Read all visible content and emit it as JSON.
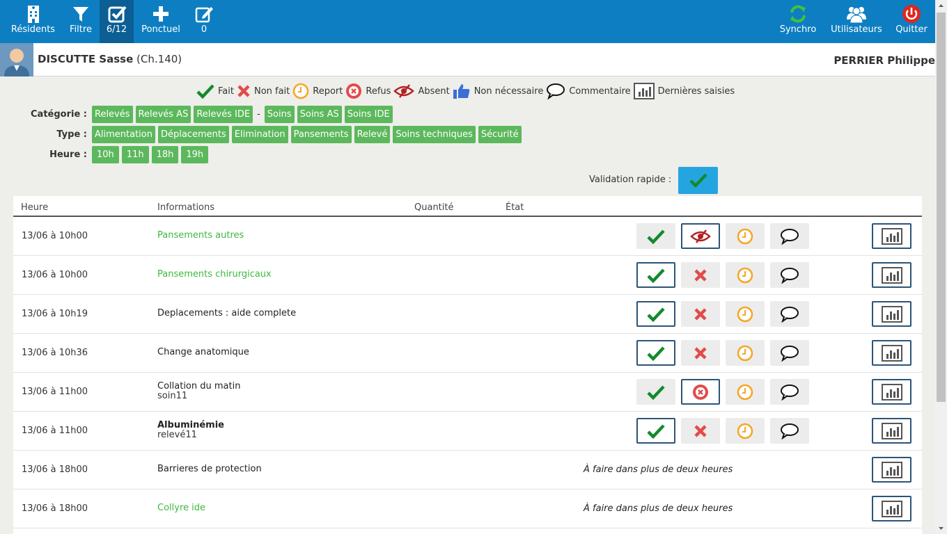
{
  "nav": {
    "residents": "Résidents",
    "filter": "Filtre",
    "progress": "6/12",
    "ponctuel": "Ponctuel",
    "drafts": "0",
    "sync": "Synchro",
    "users": "Utilisateurs",
    "quit": "Quitter"
  },
  "resident": {
    "name": "DISCUTTE Sasse",
    "room": "(Ch.140)",
    "user": "PERRIER Philippe"
  },
  "legend": {
    "done": "Fait",
    "not_done": "Non fait",
    "postpone": "Report",
    "refusal": "Refus",
    "absent": "Absent",
    "not_needed": "Non nécessaire",
    "comment": "Commentaire",
    "last_entries": "Dernières saisies"
  },
  "filters": {
    "category_label": "Catégorie :",
    "categories_a": [
      "Relevés",
      "Relevés AS",
      "Relevés IDE"
    ],
    "category_sep": "-",
    "categories_b": [
      "Soins",
      "Soins AS",
      "Soins IDE"
    ],
    "type_label": "Type :",
    "types": [
      "Alimentation",
      "Déplacements",
      "Elimination",
      "Pansements",
      "Relevé",
      "Soins techniques",
      "Sécurité"
    ],
    "hour_label": "Heure :",
    "hours": [
      "10h",
      "11h",
      "18h",
      "19h"
    ]
  },
  "quick_validation": "Validation rapide :",
  "table": {
    "headers": {
      "time": "Heure",
      "info": "Informations",
      "qty": "Quantité",
      "state": "État"
    },
    "rows": [
      {
        "time": "13/06 à 10h00",
        "title": "Pansements autres",
        "sub": "",
        "second": "absent",
        "selected": "second",
        "note": ""
      },
      {
        "time": "13/06 à 10h00",
        "title": "Pansements chirurgicaux",
        "sub": "",
        "second": "cross",
        "selected": "done",
        "note": ""
      },
      {
        "time": "13/06 à 10h19",
        "title": "Deplacements : aide complete",
        "sub": "",
        "second": "cross",
        "selected": "done",
        "note": ""
      },
      {
        "time": "13/06 à 10h36",
        "title": "Change anatomique",
        "sub": "",
        "second": "cross",
        "selected": "done",
        "note": ""
      },
      {
        "time": "13/06 à 11h00",
        "title": "Collation du matin",
        "sub": "soin11",
        "second": "refus",
        "selected": "second",
        "note": ""
      },
      {
        "time": "13/06 à 11h00",
        "title": "Albuminémie",
        "sub": "relevé11",
        "second": "cross",
        "selected": "done",
        "note": ""
      },
      {
        "time": "13/06 à 18h00",
        "title": "Barrieres de protection",
        "sub": "",
        "second": "",
        "selected": "",
        "note": "À faire dans plus de deux heures"
      },
      {
        "time": "13/06 à 18h00",
        "title": "Collyre ide",
        "sub": "",
        "second": "",
        "selected": "",
        "note": "À faire dans plus de deux heures"
      }
    ]
  },
  "colors": {
    "nav_bg": "#0d7ec2",
    "chip_green": "#5cb85c",
    "soin_text_green": "#3cb93c",
    "check_green": "#138a2c",
    "cross_red": "#e24b4b",
    "clock_orange": "#f5a623",
    "absent_red": "#b22222",
    "quit_red": "#e0261e",
    "sync_green": "#3fc23f",
    "selected_border": "#2b5478"
  }
}
